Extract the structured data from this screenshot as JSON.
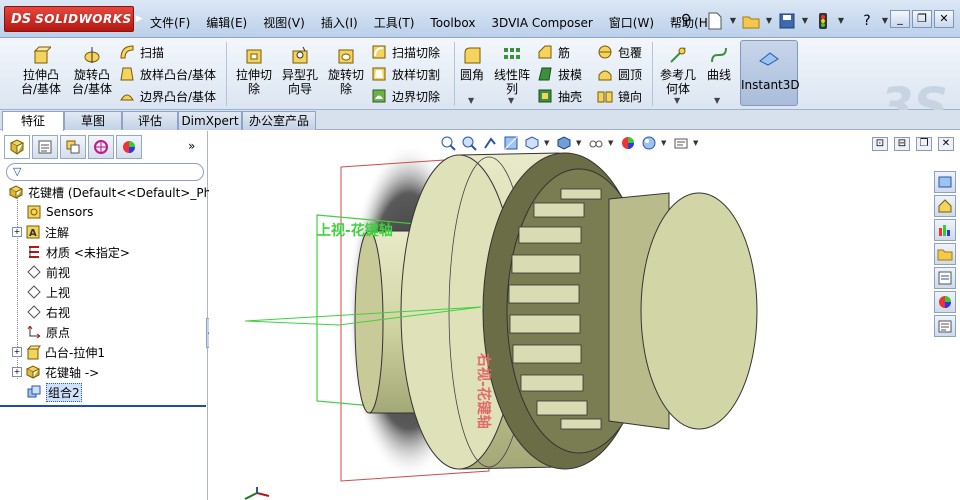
{
  "app": {
    "brand": "SOLIDWORKS",
    "logo_mark": "DS"
  },
  "menu": [
    "文件(F)",
    "编辑(E)",
    "视图(V)",
    "插入(I)",
    "工具(T)",
    "Toolbox",
    "3DVIA Composer",
    "窗口(W)",
    "帮助(H)"
  ],
  "quick_tools": [
    "new-document-icon",
    "open-folder-icon",
    "save-icon",
    "traffic-light-icon",
    "help-icon"
  ],
  "window_buttons": [
    "_",
    "❐",
    "✕"
  ],
  "command_manager": {
    "features": {
      "extrude_boss": "拉伸凸台/基体",
      "revolve_boss": "旋转凸台/基体",
      "sweep": "扫描",
      "loft": "放样凸台/基体",
      "boundary_boss": "边界凸台/基体",
      "extrude_cut": "拉伸切除",
      "hole_wizard": "异型孔向导",
      "revolve_cut": "旋转切除",
      "swept_cut": "扫描切除",
      "lofted_cut": "放样切割",
      "boundary_cut": "边界切除",
      "fillet": "圆角",
      "linear_pattern": "线性阵列",
      "rib": "筋",
      "draft": "拔模",
      "shell": "抽壳",
      "wrap": "包覆",
      "dome": "圆顶",
      "mirror": "镜向",
      "ref_geometry": "参考几何体",
      "curves": "曲线",
      "instant3d": "Instant3D"
    }
  },
  "tabs": [
    "特征",
    "草图",
    "评估",
    "DimXpert",
    "办公室产品"
  ],
  "panel": {
    "expand_glyph": "»",
    "tree": [
      {
        "label": "花键槽  (Default<<Default>_Ph",
        "icon": "part-icon"
      },
      {
        "label": "Sensors",
        "icon": "sensors-icon"
      },
      {
        "label": "注解",
        "icon": "annotations-icon"
      },
      {
        "label": "材质 <未指定>",
        "icon": "material-icon"
      },
      {
        "label": "前视",
        "icon": "plane-icon"
      },
      {
        "label": "上视",
        "icon": "plane-icon"
      },
      {
        "label": "右视",
        "icon": "plane-icon"
      },
      {
        "label": "原点",
        "icon": "origin-icon"
      },
      {
        "label": "凸台-拉伸1",
        "icon": "extrude-icon"
      },
      {
        "label": "花键轴 ->",
        "icon": "part-icon"
      },
      {
        "label": "组合2",
        "icon": "combine-icon"
      }
    ]
  },
  "viewport": {
    "plane_labels": {
      "top_plane": "上视-花键轴",
      "right_plane": "右视-花键轴"
    }
  },
  "task_pane": [
    "resources-icon",
    "design-library-icon",
    "file-explorer-icon",
    "view-palette-icon",
    "appearances-icon",
    "custom-properties-icon",
    "toolbox-icon"
  ]
}
